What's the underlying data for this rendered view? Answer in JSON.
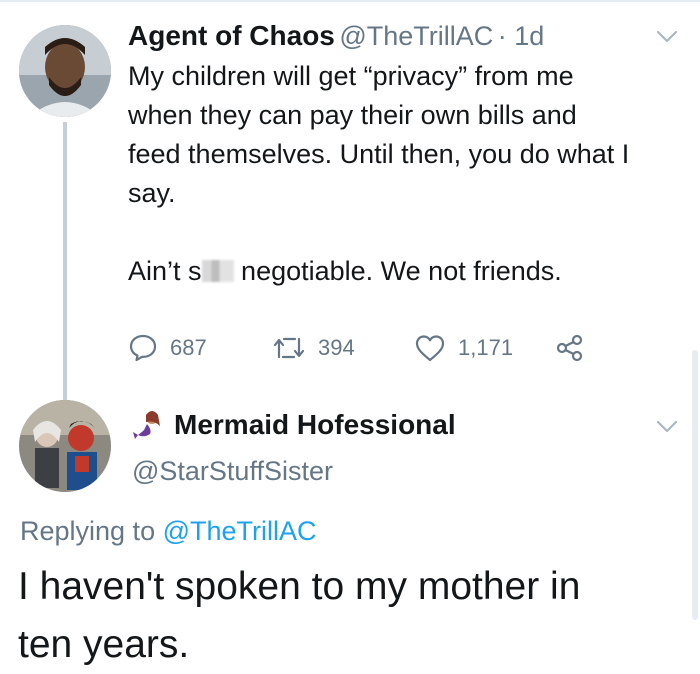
{
  "tweet": {
    "author_name": "Agent of Chaos",
    "author_handle": "@TheTrillAC",
    "time": "· 1d",
    "text_line1": "My children will get “privacy” from me",
    "text_line2": "when they can pay their own bills and",
    "text_line3": "feed themselves. Until then, you do what I",
    "text_line4": "say.",
    "text_line5_pre": "Ain’t s",
    "text_line5_post": "negotiable. We not friends.",
    "reply_count": "687",
    "retweet_count": "394",
    "like_count": "1,171"
  },
  "reply": {
    "author_name": "Mermaid Hofessional",
    "author_handle": "@StarStuffSister",
    "emoji": "mermaid-emoji",
    "replying_label": "Replying to ",
    "replying_handle": "@TheTrillAC",
    "text_line1": "I haven't spoken to my mother in",
    "text_line2": "ten years."
  },
  "colors": {
    "link": "#1da1f2",
    "secondary": "#657786",
    "thread_line": "#c4cfd6"
  }
}
